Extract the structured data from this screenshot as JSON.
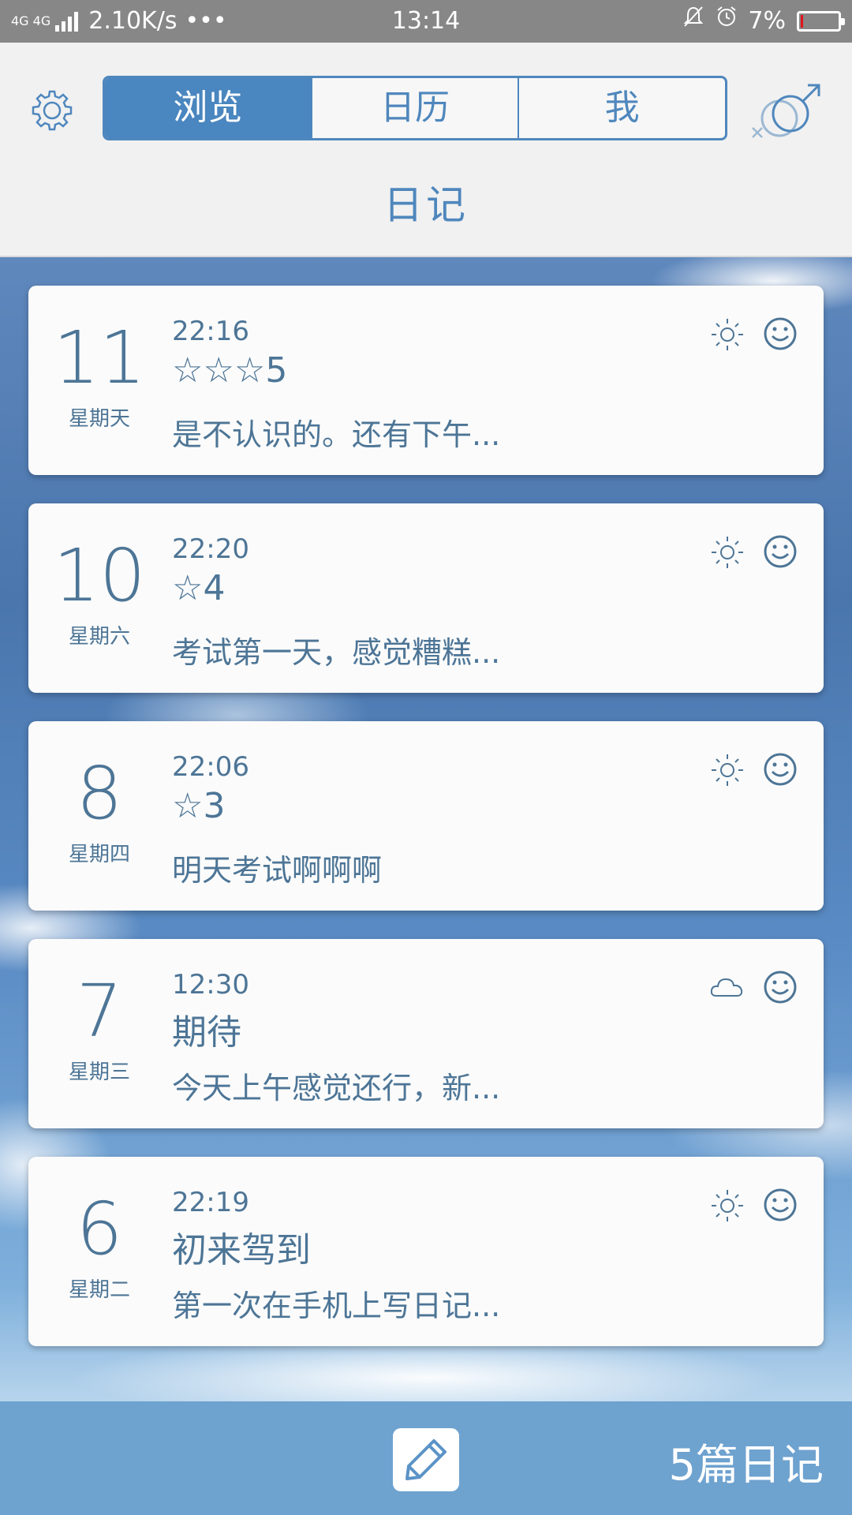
{
  "status_bar": {
    "network": "4G 4G",
    "speed": "2.10K/s",
    "dots": "•••",
    "time": "13:14",
    "battery": "7%",
    "battery_level": 0.07,
    "icons": [
      "signal-icon",
      "silent-bell-icon",
      "alarm-icon",
      "battery-icon"
    ]
  },
  "header": {
    "tabs": [
      {
        "label": "浏览",
        "active": true
      },
      {
        "label": "日历",
        "active": false
      },
      {
        "label": "我",
        "active": false
      }
    ],
    "title": "日记",
    "icons": [
      "gear-icon",
      "gender-icon"
    ]
  },
  "entries": [
    {
      "day": "11",
      "weekday": "星期天",
      "time": "22:16",
      "title": "☆☆☆5",
      "preview": "是不认识的。还有下午...",
      "weather": "sun-icon",
      "mood": "smile-icon"
    },
    {
      "day": "10",
      "weekday": "星期六",
      "time": "22:20",
      "title": "☆4",
      "preview": "考试第一天，感觉糟糕...",
      "weather": "sun-icon",
      "mood": "smile-icon"
    },
    {
      "day": "8",
      "weekday": "星期四",
      "time": "22:06",
      "title": "☆3",
      "preview": "明天考试啊啊啊",
      "weather": "sun-icon",
      "mood": "smile-icon"
    },
    {
      "day": "7",
      "weekday": "星期三",
      "time": "12:30",
      "title": "期待",
      "preview": "今天上午感觉还行，新...",
      "weather": "cloud-icon",
      "mood": "smile-icon"
    },
    {
      "day": "6",
      "weekday": "星期二",
      "time": "22:19",
      "title": "初来驾到",
      "preview": "第一次在手机上写日记...",
      "weather": "sun-icon",
      "mood": "smile-icon"
    }
  ],
  "footer": {
    "count": "5篇日记",
    "write_icon": "pencil-icon"
  },
  "colors": {
    "accent": "#4a86bf",
    "text": "#4d7596",
    "footer": "#6ea2cf",
    "battery_low": "#e2141c"
  }
}
